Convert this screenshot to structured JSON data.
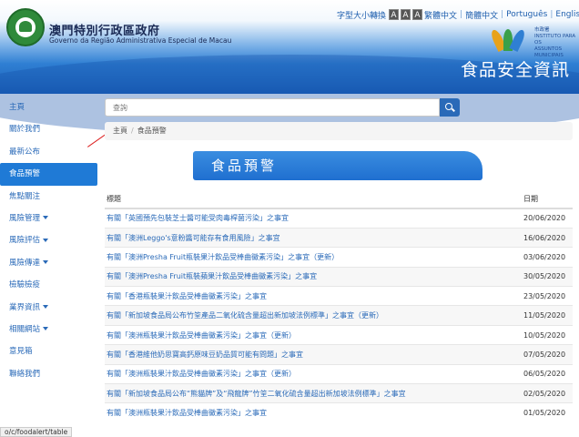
{
  "header": {
    "gov_name_zh": "澳門特別行政區政府",
    "gov_name_pt": "Governo da Região Administrativa Especial de Macau",
    "site_title": "食品安全資訊",
    "iam_text_line1": "市政署",
    "iam_text_line2": "INSTITUTO PARA OS",
    "iam_text_line3": "ASSUNTOS MUNICIPAIS"
  },
  "topnav": {
    "font_size_label": "字型大小轉換",
    "font_buttons": [
      "A",
      "A",
      "A"
    ],
    "lang_trad": "繁體中文",
    "lang_simp": "簡體中文",
    "lang_pt": "Português",
    "lang_en": "English"
  },
  "search": {
    "placeholder": "查詢"
  },
  "breadcrumb": {
    "home": "主頁",
    "current": "食品預警"
  },
  "banner": {
    "title": "食品預警"
  },
  "sidebar": {
    "items": [
      {
        "label": "主頁",
        "caret": false
      },
      {
        "label": "關於我們",
        "caret": false
      },
      {
        "label": "最新公布",
        "caret": false
      },
      {
        "label": "食品預警",
        "caret": false,
        "active": true
      },
      {
        "label": "焦點關注",
        "caret": false
      },
      {
        "label": "風險管理",
        "caret": true
      },
      {
        "label": "風險評估",
        "caret": true
      },
      {
        "label": "風險傳達",
        "caret": true
      },
      {
        "label": "檢驗檢疫",
        "caret": false
      },
      {
        "label": "業界資訊",
        "caret": true
      },
      {
        "label": "相關網站",
        "caret": true
      },
      {
        "label": "意見箱",
        "caret": false
      },
      {
        "label": "聯絡我們",
        "caret": false
      }
    ]
  },
  "table": {
    "col_title": "標題",
    "col_date": "日期",
    "rows": [
      {
        "title": "有關「英國預先包裝芝士醬可能受肉毒桿菌污染」之事宜",
        "date": "20/06/2020"
      },
      {
        "title": "有關「澳洲Leggo's意粉醬可能存有食用風險」之事宜",
        "date": "16/06/2020"
      },
      {
        "title": "有關「澳洲Presha Fruit瓶裝果汁飲品受棒曲黴素污染」之事宜（更新）",
        "date": "03/06/2020"
      },
      {
        "title": "有關「澳洲Presha Fruit瓶裝蘋果汁飲品受棒曲黴素污染」之事宜",
        "date": "30/05/2020"
      },
      {
        "title": "有關「香港瓶裝果汁飲品受棒曲黴素污染」之事宜",
        "date": "23/05/2020"
      },
      {
        "title": "有關「新加坡食品局公布竹筌產品二氧化硫含量超出新加坡法例標準」之事宜（更新）",
        "date": "11/05/2020"
      },
      {
        "title": "有關「澳洲瓶裝果汁飲品受棒曲黴素污染」之事宜（更新）",
        "date": "10/05/2020"
      },
      {
        "title": "有關「香港維他奶思寶高鈣原味豆奶品質可能有問題」之事宜",
        "date": "07/05/2020"
      },
      {
        "title": "有關「澳洲瓶裝果汁飲品受棒曲黴素污染」之事宜（更新）",
        "date": "06/05/2020"
      },
      {
        "title": "有關「新加坡食品局公布“熊貓牌”及“飛龍牌”竹筌二氧化硫含量超出新加坡法例標準」之事宜",
        "date": "02/05/2020"
      },
      {
        "title": "有關「澳洲瓶裝果汁飲品受棒曲黴素污染」之事宜",
        "date": "01/05/2020"
      }
    ]
  },
  "status_bar": {
    "url": "o/c/foodalert/table"
  },
  "colors": {
    "accent": "#1f7ad6",
    "link": "#2a6ab8",
    "header_dark": "#1a5fb8"
  }
}
